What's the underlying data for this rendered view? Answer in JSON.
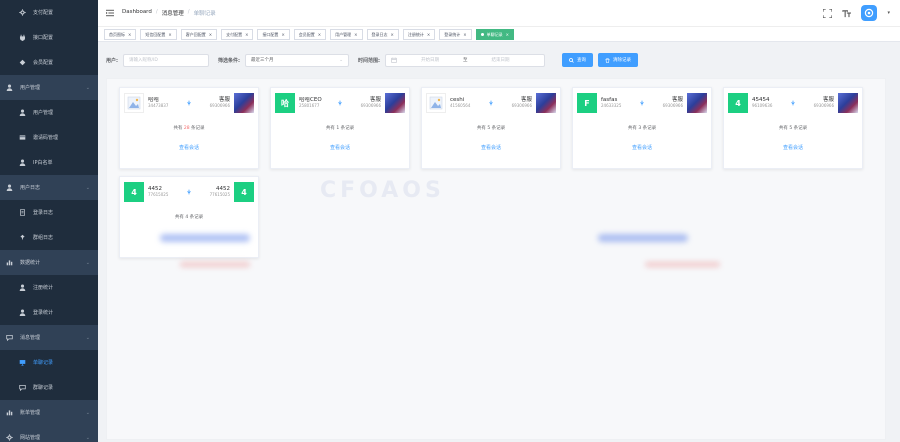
{
  "sidebar": {
    "items": [
      {
        "label": "支付配置",
        "icon": "gear-icon",
        "kind": "top"
      },
      {
        "label": "接口配置",
        "icon": "plug-icon",
        "kind": "top"
      },
      {
        "label": "会员配置",
        "icon": "diamond-icon",
        "kind": "top"
      },
      {
        "label": "用户管理",
        "icon": "user-icon",
        "kind": "grp"
      },
      {
        "label": "用户管理",
        "icon": "user-icon",
        "kind": "sub"
      },
      {
        "label": "邀请码管理",
        "icon": "card-icon",
        "kind": "sub"
      },
      {
        "label": "IP白名单",
        "icon": "user-icon",
        "kind": "sub"
      },
      {
        "label": "用户日志",
        "icon": "user-icon",
        "kind": "grp"
      },
      {
        "label": "登录日志",
        "icon": "doc-icon",
        "kind": "sub"
      },
      {
        "label": "群组日志",
        "icon": "pin-icon",
        "kind": "sub"
      },
      {
        "label": "数据统计",
        "icon": "chart-icon",
        "kind": "grp"
      },
      {
        "label": "注册统计",
        "icon": "user-icon",
        "kind": "sub"
      },
      {
        "label": "登录统计",
        "icon": "user-icon",
        "kind": "sub"
      },
      {
        "label": "消息管理",
        "icon": "chat-icon",
        "kind": "grp"
      },
      {
        "label": "单聊记录",
        "icon": "monitor-icon",
        "kind": "sub",
        "active": true
      },
      {
        "label": "群聊记录",
        "icon": "chat-icon",
        "kind": "sub"
      },
      {
        "label": "账单管理",
        "icon": "chart-icon",
        "kind": "grp"
      },
      {
        "label": "网站管理",
        "icon": "gear-icon",
        "kind": "grp"
      }
    ]
  },
  "header": {
    "breadcrumb": [
      "Dashboard",
      "消息管理",
      "单聊记录"
    ],
    "avatar_glyph": "@"
  },
  "tags": [
    {
      "label": "首页图标",
      "active": false
    },
    {
      "label": "短信回配置",
      "active": false
    },
    {
      "label": "客户回配置",
      "active": false
    },
    {
      "label": "支付配置",
      "active": false
    },
    {
      "label": "接口配置",
      "active": false
    },
    {
      "label": "会员配置",
      "active": false
    },
    {
      "label": "用户管理",
      "active": false
    },
    {
      "label": "登录日志",
      "active": false
    },
    {
      "label": "注册统计",
      "active": false
    },
    {
      "label": "登录统计",
      "active": false
    },
    {
      "label": "单聊记录",
      "active": true
    }
  ],
  "filters": {
    "user_label": "用户:",
    "user_placeholder": "请输入昵称/ID",
    "condition_label": "筛选条件:",
    "condition_value": "最近三个月",
    "time_label": "时间范围:",
    "start_placeholder": "开始日期",
    "range_sep": "至",
    "end_placeholder": "结束日期",
    "search_button": "查询",
    "clear_button": "清除记录"
  },
  "cards": [
    {
      "user_name": "哈哈",
      "user_id": "34473837",
      "user_chip": "",
      "user_image": true,
      "kefu_name": "客服",
      "kefu_id": "69306966",
      "count_prefix": "共有",
      "count": "28",
      "count_suffix": "条记录",
      "count_highlight": true,
      "view": "查看会话"
    },
    {
      "user_name": "哈哈CEO",
      "user_id": "25801677",
      "user_chip": "哈",
      "user_image": false,
      "kefu_name": "客服",
      "kefu_id": "69306966",
      "count_prefix": "共有",
      "count": "1",
      "count_suffix": "条记录",
      "count_highlight": false,
      "view": "查看会话"
    },
    {
      "user_name": "ceshi",
      "user_id": "41560564",
      "user_chip": "",
      "user_image": true,
      "kefu_name": "客服",
      "kefu_id": "69306966",
      "count_prefix": "共有",
      "count": "5",
      "count_suffix": "条记录",
      "count_highlight": false,
      "view": "查看会话"
    },
    {
      "user_name": "fasfas",
      "user_id": "24633325",
      "user_chip": "F",
      "user_image": false,
      "kefu_name": "客服",
      "kefu_id": "69306966",
      "count_prefix": "共有",
      "count": "3",
      "count_suffix": "条记录",
      "count_highlight": false,
      "view": "查看会话"
    },
    {
      "user_name": "45454",
      "user_id": "96109636",
      "user_chip": "4",
      "user_image": false,
      "kefu_name": "客服",
      "kefu_id": "69306966",
      "count_prefix": "共有",
      "count": "5",
      "count_suffix": "条记录",
      "count_highlight": false,
      "view": "查看会话"
    },
    {
      "user_name": "4452",
      "user_id": "77615025",
      "user_chip": "4",
      "user_image": false,
      "kefu_name": "4452",
      "kefu_id": "77615025",
      "kefu_chip": "4",
      "count_prefix": "共有",
      "count": "4",
      "count_suffix": "条记录",
      "count_highlight": false,
      "view": ""
    }
  ],
  "colors": {
    "accent": "#409eff",
    "active_tag": "#42b983",
    "chip": "#1ccf82",
    "sidebar": "#304156"
  }
}
